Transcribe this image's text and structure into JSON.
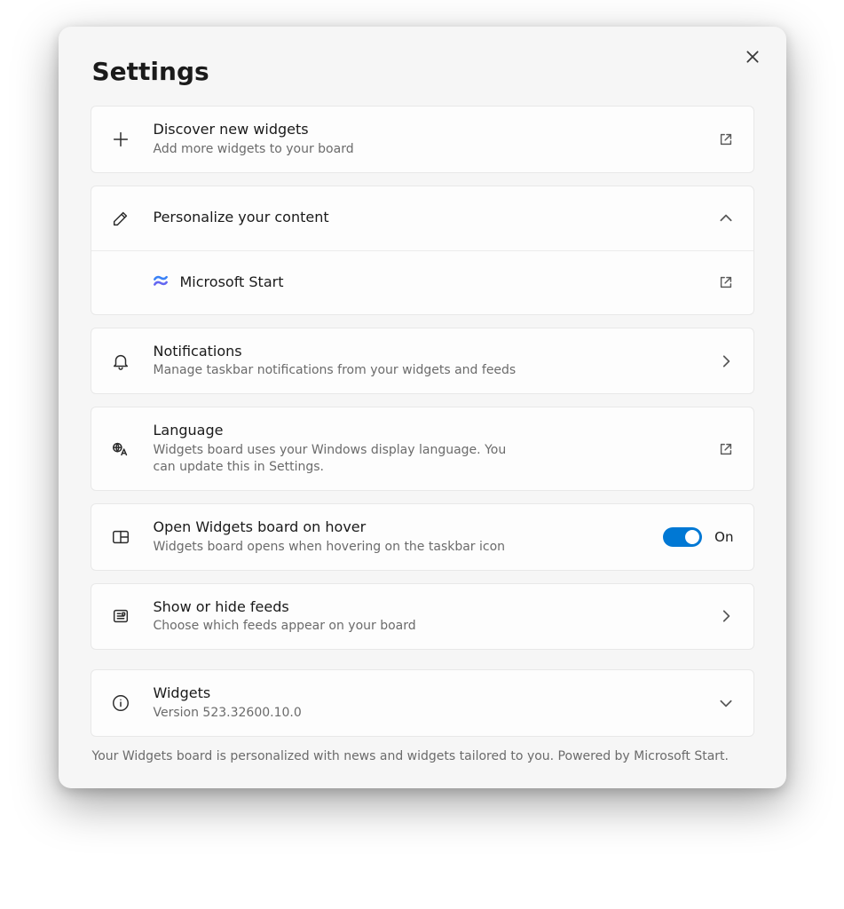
{
  "title": "Settings",
  "discover": {
    "title": "Discover new widgets",
    "subtitle": "Add more widgets to your board"
  },
  "personalize": {
    "title": "Personalize your content",
    "msstart": "Microsoft Start"
  },
  "notifications": {
    "title": "Notifications",
    "subtitle": "Manage taskbar notifications from your widgets and feeds"
  },
  "language": {
    "title": "Language",
    "subtitle": "Widgets board uses your Windows display language. You can update this in Settings."
  },
  "hover": {
    "title": "Open Widgets board on hover",
    "subtitle": "Widgets board opens when hovering on the taskbar icon",
    "toggle_label": "On"
  },
  "feeds": {
    "title": "Show or hide feeds",
    "subtitle": "Choose which feeds appear on your board"
  },
  "about": {
    "title": "Widgets",
    "version": "Version 523.32600.10.0"
  },
  "footer": "Your Widgets board is personalized with news and widgets tailored to you. Powered by Microsoft Start."
}
